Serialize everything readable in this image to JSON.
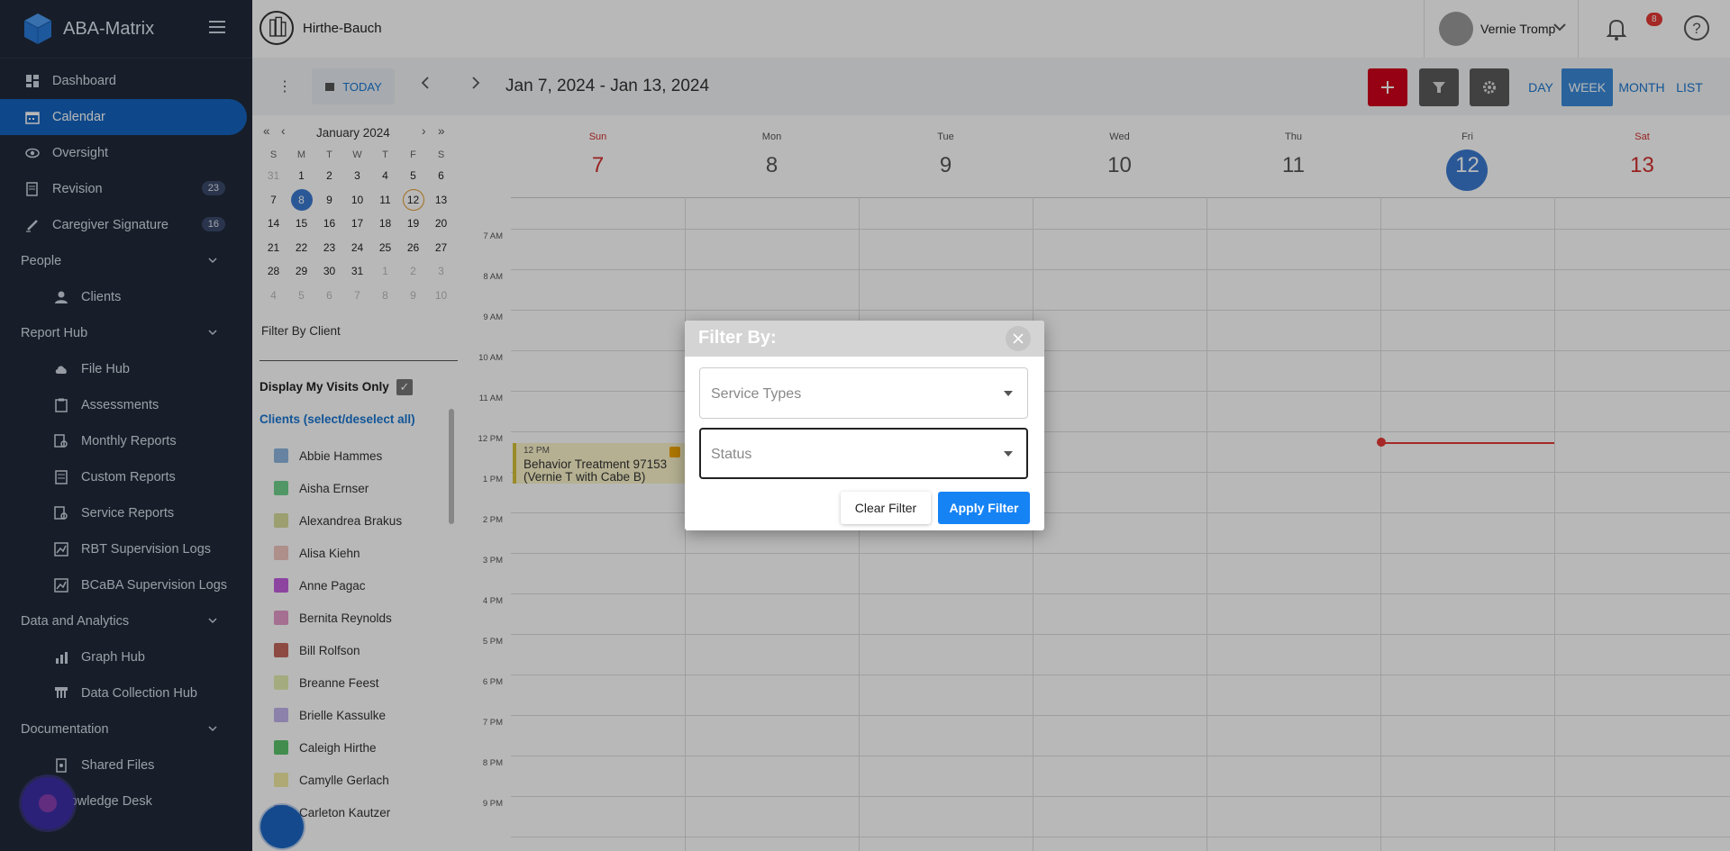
{
  "app": {
    "name": "ABA-Matrix"
  },
  "sidebar": {
    "items": [
      {
        "label": "Dashboard"
      },
      {
        "label": "Calendar"
      },
      {
        "label": "Oversight"
      },
      {
        "label": "Revision",
        "badge": "23"
      },
      {
        "label": "Caregiver Signature",
        "badge": "16"
      },
      {
        "label": "People"
      },
      {
        "label": "Clients"
      },
      {
        "label": "Report Hub"
      },
      {
        "label": "File Hub"
      },
      {
        "label": "Assessments"
      },
      {
        "label": "Monthly Reports"
      },
      {
        "label": "Custom Reports"
      },
      {
        "label": "Service Reports"
      },
      {
        "label": "RBT Supervision Logs"
      },
      {
        "label": "BCaBA Supervision Logs"
      },
      {
        "label": "Data and Analytics"
      },
      {
        "label": "Graph Hub"
      },
      {
        "label": "Data Collection Hub"
      },
      {
        "label": "Documentation"
      },
      {
        "label": "Shared Files"
      },
      {
        "label": "Knowledge Desk"
      }
    ]
  },
  "header": {
    "org_name": "Hirthe-Bauch",
    "user_name": "Vernie Tromp",
    "notifications": "8"
  },
  "toolbar": {
    "today_label": "TODAY",
    "range": "Jan 7, 2024 - Jan 13, 2024",
    "views": [
      "DAY",
      "WEEK",
      "MONTH",
      "LIST"
    ],
    "active_view": "WEEK",
    "accent_add": "#d0021b"
  },
  "mini_calendar": {
    "title": "January 2024",
    "dow": [
      "S",
      "M",
      "T",
      "W",
      "T",
      "F",
      "S"
    ],
    "weeks": [
      [
        "31",
        "1",
        "2",
        "3",
        "4",
        "5",
        "6"
      ],
      [
        "7",
        "8",
        "9",
        "10",
        "11",
        "12",
        "13"
      ],
      [
        "14",
        "15",
        "16",
        "17",
        "18",
        "19",
        "20"
      ],
      [
        "21",
        "22",
        "23",
        "24",
        "25",
        "26",
        "27"
      ],
      [
        "28",
        "29",
        "30",
        "31",
        "1",
        "2",
        "3"
      ],
      [
        "4",
        "5",
        "6",
        "7",
        "8",
        "9",
        "10"
      ]
    ]
  },
  "filters": {
    "filter_by_client": "Filter By Client",
    "my_visits_label": "Display My Visits Only",
    "clients_title": "Clients (select/deselect all)",
    "clients": [
      {
        "name": "Abbie Hammes",
        "color": "#8fb6e0"
      },
      {
        "name": "Aisha Ernser",
        "color": "#6fd18d"
      },
      {
        "name": "Alexandrea Brakus",
        "color": "#d9dd9a"
      },
      {
        "name": "Alisa Kiehn",
        "color": "#f2c6c0"
      },
      {
        "name": "Anne Pagac",
        "color": "#c45fe0"
      },
      {
        "name": "Bernita Reynolds",
        "color": "#e59ac9"
      },
      {
        "name": "Bill Rolfson",
        "color": "#c2675e"
      },
      {
        "name": "Breanne Feest",
        "color": "#e4efb0"
      },
      {
        "name": "Brielle Kassulke",
        "color": "#c2b3ee"
      },
      {
        "name": "Caleigh Hirthe",
        "color": "#5cc46c"
      },
      {
        "name": "Camylle Gerlach",
        "color": "#f2eaa2"
      },
      {
        "name": "Carleton Kautzer",
        "color": "#b889e0"
      }
    ]
  },
  "week": {
    "days": [
      {
        "name": "Sun",
        "num": "7"
      },
      {
        "name": "Mon",
        "num": "8"
      },
      {
        "name": "Tue",
        "num": "9"
      },
      {
        "name": "Wed",
        "num": "10"
      },
      {
        "name": "Thu",
        "num": "11"
      },
      {
        "name": "Fri",
        "num": "12"
      },
      {
        "name": "Sat",
        "num": "13"
      }
    ],
    "hours": [
      "7 AM",
      "8 AM",
      "9 AM",
      "10 AM",
      "11 AM",
      "12 PM",
      "1 PM",
      "2 PM",
      "3 PM",
      "4 PM",
      "5 PM",
      "6 PM",
      "7 PM",
      "8 PM",
      "9 PM"
    ],
    "event": {
      "time": "12 PM",
      "title": "Behavior Treatment 97153",
      "subtitle": "(Vernie T with Cabe B)"
    }
  },
  "modal": {
    "title": "Filter By:",
    "service_types_placeholder": "Service Types",
    "status_placeholder": "Status",
    "clear_label": "Clear Filter",
    "apply_label": "Apply Filter"
  }
}
